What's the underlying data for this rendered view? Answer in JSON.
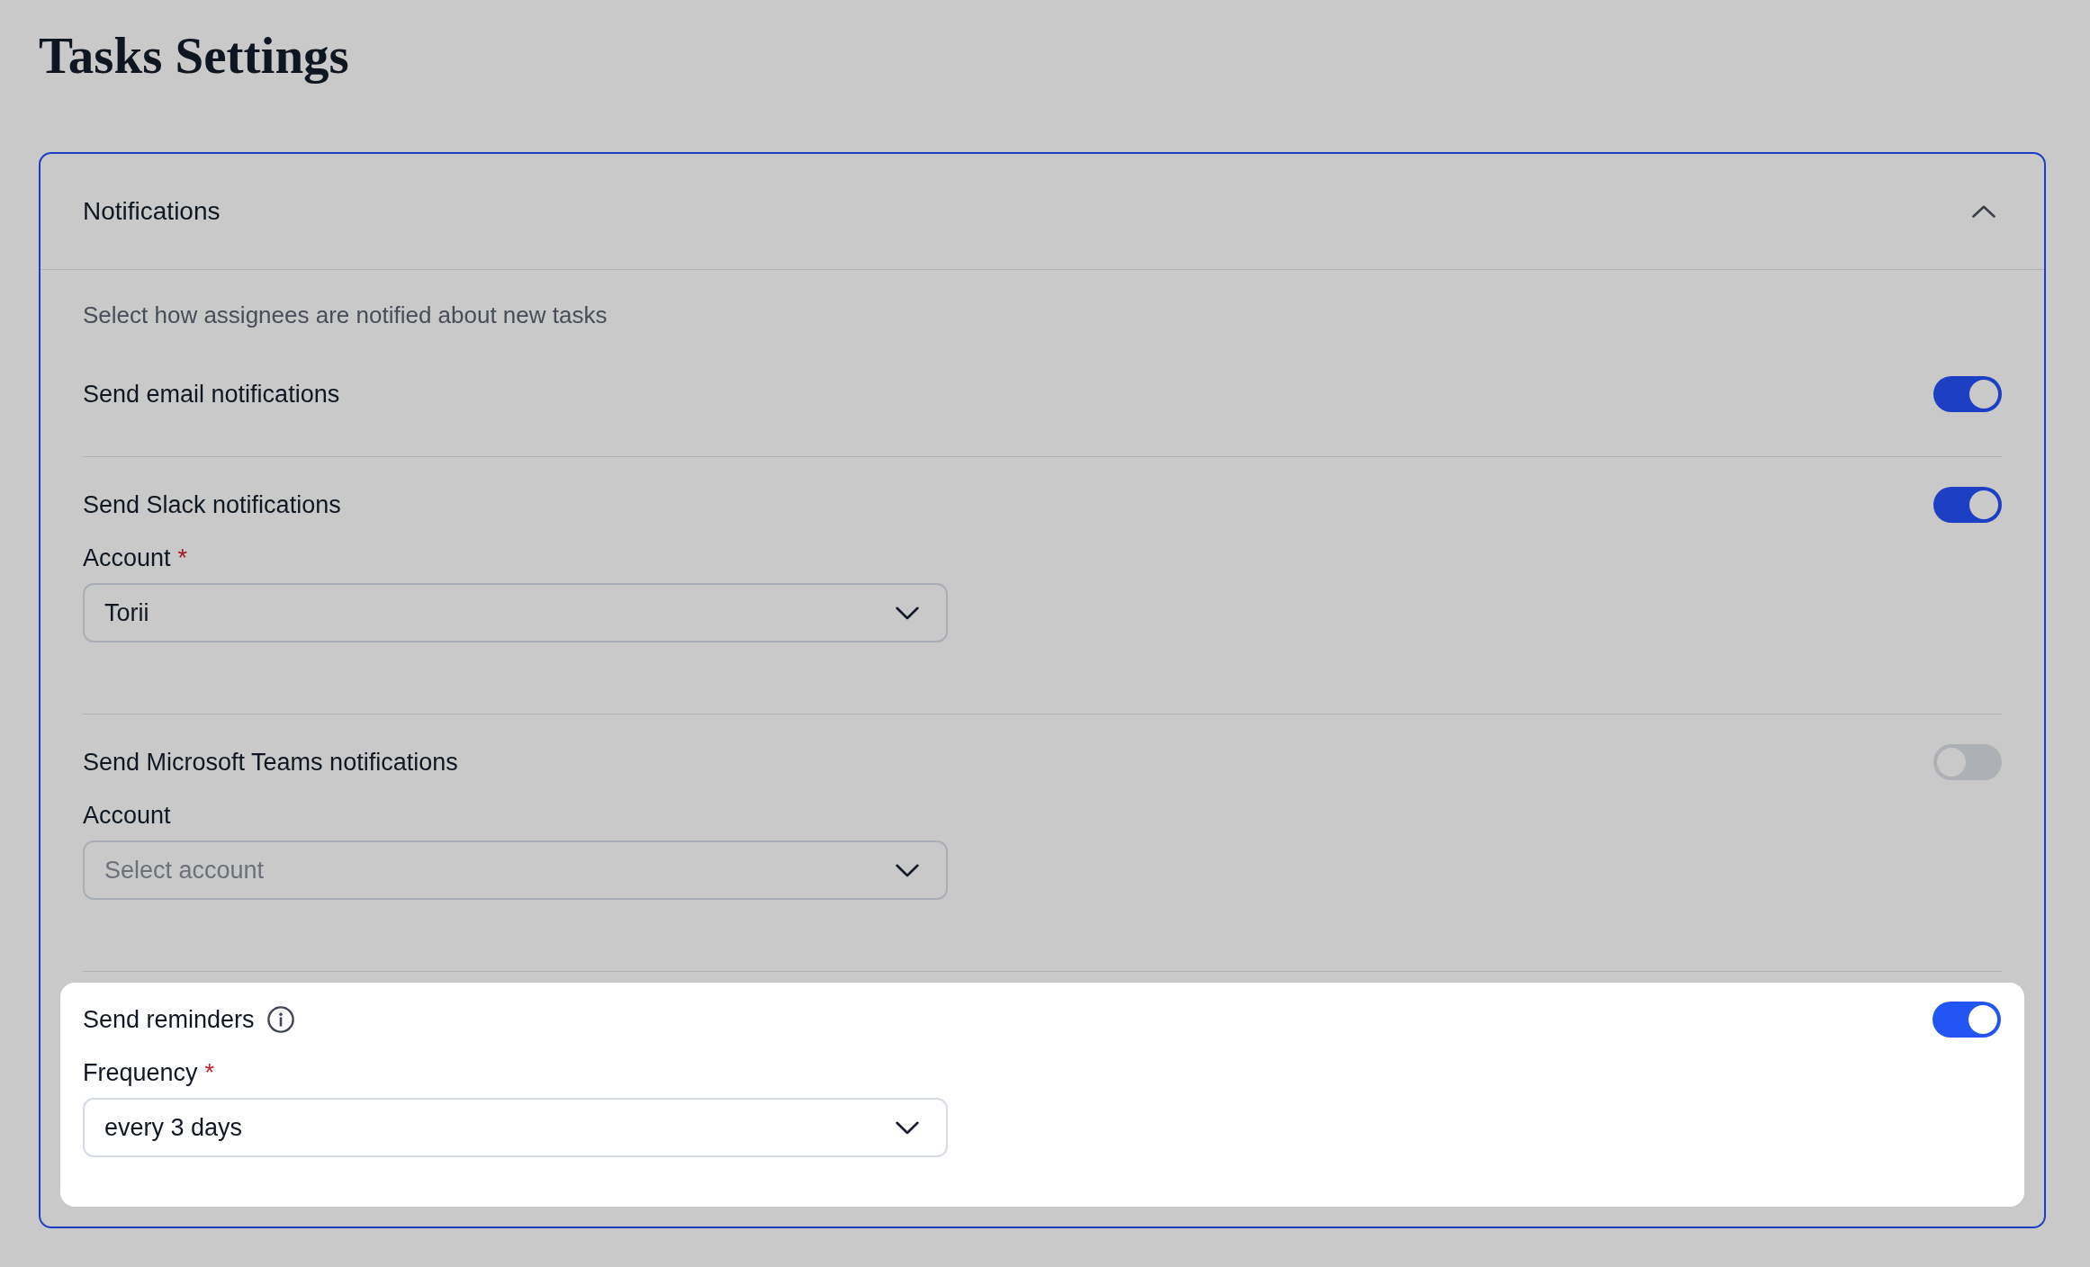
{
  "page": {
    "title": "Tasks Settings"
  },
  "section": {
    "title": "Notifications",
    "expanded": true,
    "description": "Select how assignees are notified about new tasks",
    "settings": [
      {
        "label": "Send email notifications",
        "info": false,
        "on": true,
        "highlighted": false
      },
      {
        "label": "Send Slack notifications",
        "info": false,
        "on": true,
        "highlighted": false,
        "field": {
          "label": "Account",
          "required_mark": "*",
          "value": "Torii"
        }
      },
      {
        "label": "Send Microsoft Teams notifications",
        "info": false,
        "on": false,
        "highlighted": false,
        "field": {
          "label": "Account",
          "placeholder": "Select account"
        }
      },
      {
        "label": "Send reminders",
        "info": true,
        "on": true,
        "highlighted": true,
        "field": {
          "label": "Frequency",
          "required_mark": "*",
          "value": "every 3 days"
        }
      }
    ]
  }
}
